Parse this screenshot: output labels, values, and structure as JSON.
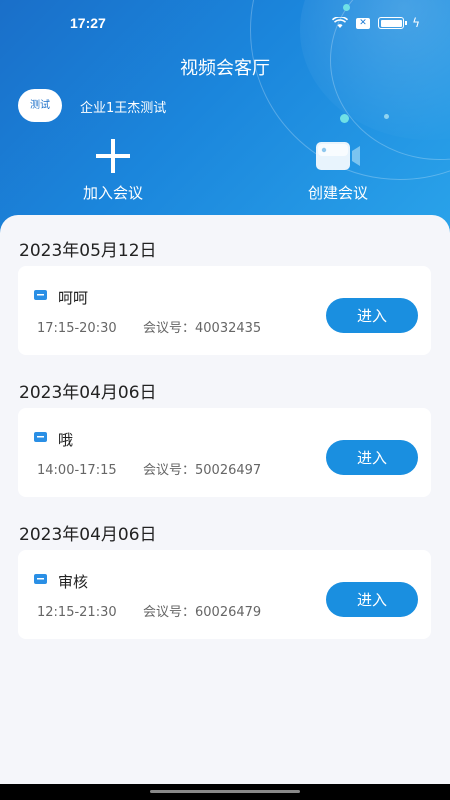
{
  "status_bar": {
    "time": "17:27",
    "icons": [
      "wifi-icon",
      "sim-x-icon",
      "battery-icon",
      "charging-icon"
    ]
  },
  "header": {
    "title": "视频会客厅",
    "avatar_label": "测试",
    "company": "企业1王杰测试",
    "actions": {
      "join": {
        "label": "加入会议",
        "icon": "plus-icon"
      },
      "create": {
        "label": "创建会议",
        "icon": "video-camera-icon"
      }
    }
  },
  "meetings": [
    {
      "date": "2023年05月12日",
      "name": "呵呵",
      "time": "17:15-20:30",
      "number_label": "会议号：",
      "number": "40032435",
      "button": "进入"
    },
    {
      "date": "2023年04月06日",
      "name": "哦",
      "time": "14:00-17:15",
      "number_label": "会议号：",
      "number": "50026497",
      "button": "进入"
    },
    {
      "date": "2023年04月06日",
      "name": "审核",
      "time": "12:15-21:30",
      "number_label": "会议号：",
      "number": "60026479",
      "button": "进入"
    }
  ],
  "colors": {
    "header_start": "#1a6fc9",
    "header_end": "#2aa3ea",
    "button": "#1a8fe0",
    "background": "#f5f6fa"
  }
}
